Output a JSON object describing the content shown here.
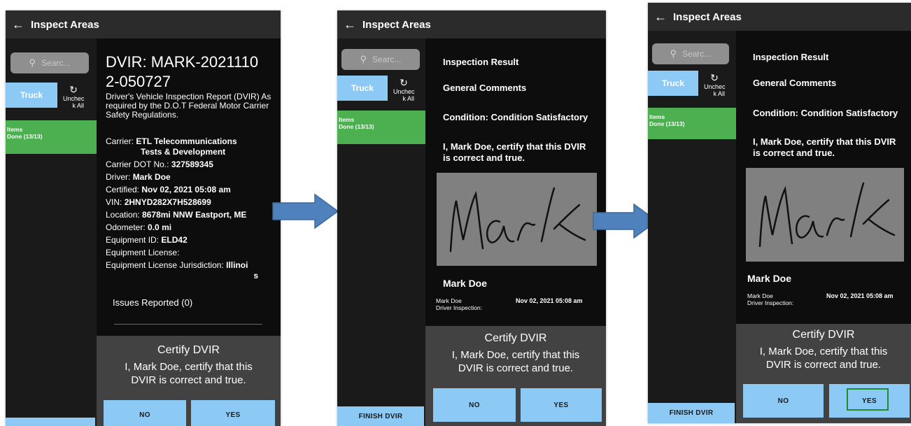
{
  "appbar": {
    "back_icon": "arrow-left-icon",
    "title": "Inspect Areas"
  },
  "sidebar": {
    "search_placeholder": "Searc...",
    "search_icon": "search-icon",
    "truck_label": "Truck",
    "uncheck_icon": "undo-icon",
    "uncheck_line1": "Unchec",
    "uncheck_line2": "k All",
    "items_label": "Items",
    "items_status": "Done (13/13)",
    "finish_label": "FINISH DVIR"
  },
  "report": {
    "title_line1": "DVIR: MARK-2021110",
    "title_line2": "2-050727",
    "description": "Driver's Vehicle Inspection Report (DVIR) As required by the D.O.T Federal Motor Carrier Safety Regulations.",
    "carrier_label": "Carrier:",
    "carrier_line1": "ETL Telecommunications",
    "carrier_line2": "Tests & Development",
    "dot_label": "Carrier DOT No.:",
    "dot_value": "327589345",
    "driver_label": "Driver:",
    "driver_value": "Mark Doe",
    "certified_label": "Certified:",
    "certified_value": "Nov 02, 2021  05:08 am",
    "vin_label": "VIN:",
    "vin_value": "2HNYD282X7H528699",
    "location_label": "Location:",
    "location_value": "8678mi NNW Eastport, ME",
    "odometer_label": "Odometer:",
    "odometer_value": "0.0 mi",
    "equipment_label": "Equipment ID:",
    "equipment_value": "ELD42",
    "license_label": "Equipment License:",
    "jurisdiction_label": "Equipment License Jurisdiction:",
    "jurisdiction_line1": "Illinoi",
    "jurisdiction_line2": "s",
    "issues": "Issues Reported (0)"
  },
  "result": {
    "heading": "Inspection Result",
    "comments": "General Comments",
    "condition": "Condition: Condition Satisfactory",
    "certify_line1": "I, Mark Doe, certify that this DVIR",
    "certify_line2": "is correct and true.",
    "signature_text": "Mark",
    "signer": "Mark Doe",
    "signer_small": "Mark Doe",
    "inspection_label": "Driver Inspection:",
    "date": "Nov 02, 2021  05:08 am"
  },
  "certify": {
    "title": "Certify DVIR",
    "line1": "I, Mark Doe, certify that this",
    "line2": "DVIR is correct and true.",
    "no": "NO",
    "yes": "YES"
  },
  "colors": {
    "accent": "#8ccaf5",
    "green": "#4caf50",
    "highlight": "#1e8c2a",
    "arrow": "#4f81bd"
  }
}
